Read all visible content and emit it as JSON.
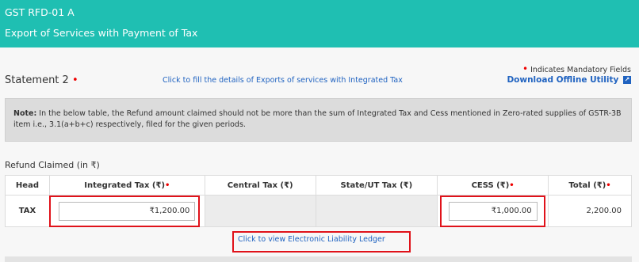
{
  "header": {
    "form_code": "GST RFD-01 A",
    "form_title": "Export of Services with Payment of Tax"
  },
  "mandatory_note": "Indicates Mandatory Fields",
  "statement": {
    "label": "Statement 2",
    "fill_link": "Click to fill the details of Exports of services with Integrated Tax",
    "download_link": "Download Offline Utility"
  },
  "note": {
    "prefix": "Note:",
    "text": "In the below table, the Refund amount claimed should not be more than the sum of Integrated Tax and Cess mentioned in Zero-rated supplies of GSTR-3B item i.e., 3.1(a+b+c) respectively, filed for the given periods."
  },
  "refund_title": "Refund Claimed (in ₹)",
  "table": {
    "headers": {
      "head": "Head",
      "integrated": "Integrated Tax (₹)",
      "central": "Central Tax (₹)",
      "state": "State/UT Tax (₹)",
      "cess": "CESS (₹)",
      "total": "Total (₹)"
    },
    "row": {
      "head": "TAX",
      "integrated": "₹1,200.00",
      "central": "",
      "state": "",
      "cess": "₹1,000.00",
      "total": "2,200.00"
    }
  },
  "ledger_link": "Click to view Electronic Liability Ledger",
  "colors": {
    "header_bg": "#1fbfb2",
    "link": "#1f62c0",
    "required": "#e00000",
    "highlight_box": "#e0121a"
  }
}
